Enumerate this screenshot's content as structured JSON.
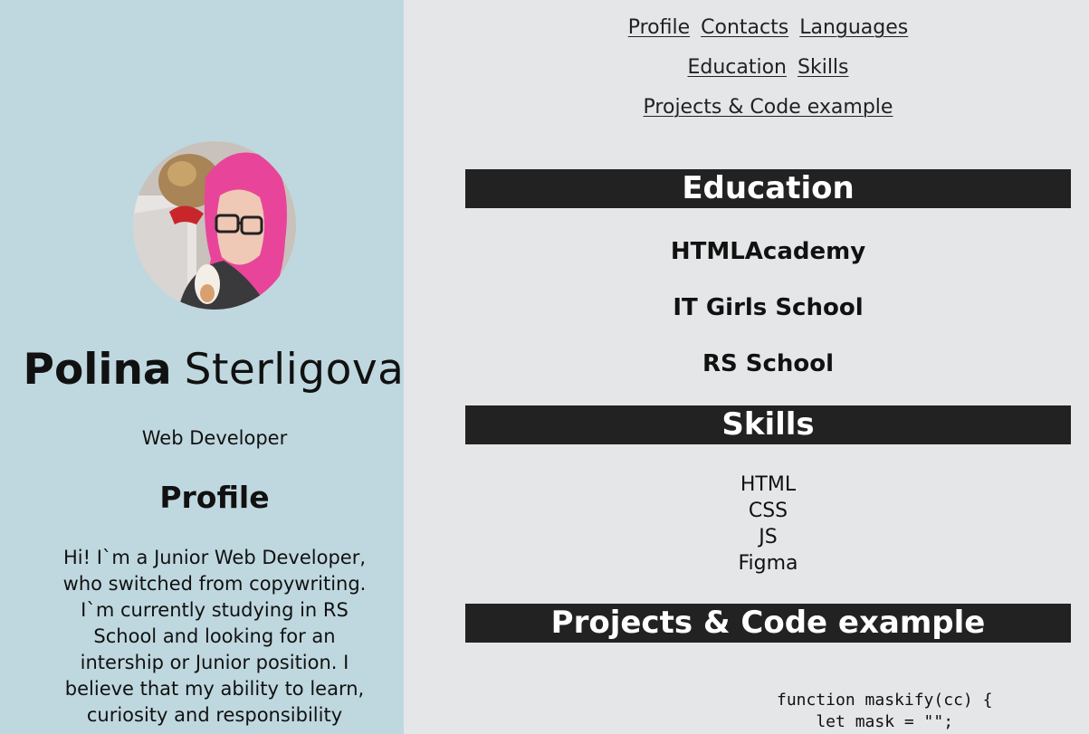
{
  "sidebar": {
    "first_name": "Polina",
    "last_name": "Sterligova",
    "job_title": "Web Developer",
    "profile_heading": "Profile",
    "profile_text": "Hi! I`m a Junior Web Developer, who switched from copywriting. I`m currently studying in RS School and looking for an intership or Junior position. I believe that my ability to learn, curiosity and responsibility"
  },
  "nav": {
    "profile": "Profile",
    "contacts": "Contacts",
    "languages": "Languages",
    "education": "Education",
    "skills": "Skills",
    "projects": "Projects & Code example"
  },
  "education": {
    "heading": "Education",
    "items": [
      "HTMLAcademy",
      "IT Girls School",
      "RS School"
    ]
  },
  "skills": {
    "heading": "Skills",
    "items": [
      "HTML",
      "CSS",
      "JS",
      "Figma"
    ]
  },
  "projects": {
    "heading": "Projects & Code example",
    "code_lines": [
      "function maskify(cc) {",
      "    let mask = \"\";"
    ]
  },
  "colors": {
    "sidebar_bg": "#bfd8df",
    "main_bg": "#e5e6e8",
    "section_bar_bg": "#222222",
    "section_bar_text": "#ffffff",
    "avatar_hair": "#e8459a"
  },
  "icons": {
    "avatar": "profile-photo"
  }
}
